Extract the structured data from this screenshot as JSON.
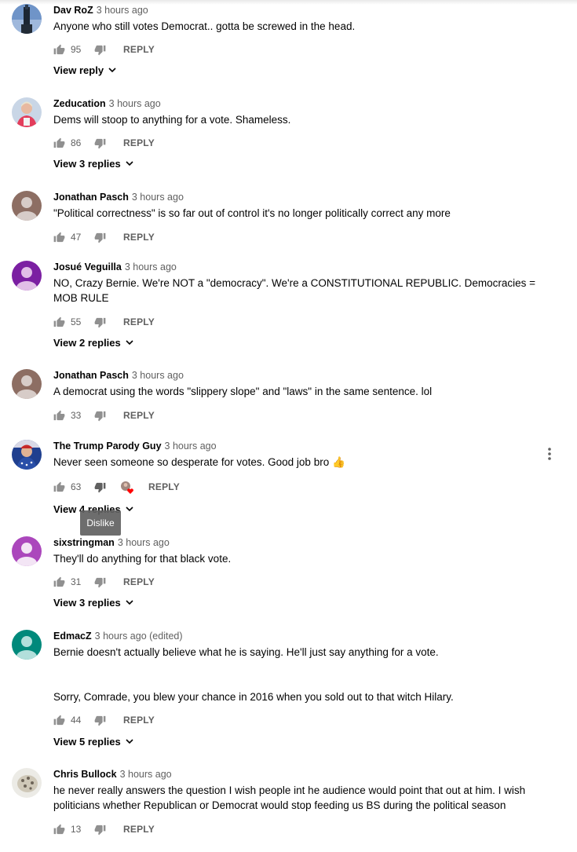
{
  "colors": {
    "text": "#030303",
    "secondary": "#606060",
    "icon": "#909090",
    "tooltip_bg": "#616161",
    "heart": "#ff0000"
  },
  "tooltip": {
    "label": "Dislike"
  },
  "comments": [
    {
      "author": "Dav RoZ",
      "time": "3 hours ago",
      "text": [
        "Anyone who still votes Democrat.. gotta be screwed in the head."
      ],
      "likes": "95",
      "reply_label": "REPLY",
      "view_replies": "View reply",
      "avatar": "tower-photo"
    },
    {
      "author": "Zeducation",
      "time": "3 hours ago",
      "text": [
        "Dems will stoop to anything for a vote. Shameless."
      ],
      "likes": "86",
      "reply_label": "REPLY",
      "view_replies": "View 3 replies",
      "avatar": "person-photo"
    },
    {
      "author": "Jonathan Pasch",
      "time": "3 hours ago",
      "text": [
        "\"Political correctness\" is so far out of control it's no longer politically correct any more"
      ],
      "likes": "47",
      "reply_label": "REPLY",
      "view_replies": "",
      "avatar": "default-brown"
    },
    {
      "author": "Josué Veguilla",
      "time": "3 hours ago",
      "text": [
        "NO, Crazy Bernie. We're NOT a \"democracy\". We're a CONSTITUTIONAL REPUBLIC. Democracies = MOB RULE"
      ],
      "likes": "55",
      "reply_label": "REPLY",
      "view_replies": "View 2 replies",
      "avatar": "default-purple"
    },
    {
      "author": "Jonathan Pasch",
      "time": "3 hours ago",
      "text": [
        "A democrat using the words \"slippery slope\" and \"laws\" in the same sentence. lol"
      ],
      "likes": "33",
      "reply_label": "REPLY",
      "view_replies": "",
      "avatar": "default-brown"
    },
    {
      "author": "The Trump Parody Guy",
      "time": "3 hours ago",
      "text": [
        "Never seen someone so desperate for votes. Good job bro 👍"
      ],
      "likes": "63",
      "reply_label": "REPLY",
      "view_replies": "View 4 replies",
      "avatar": "flag-photo",
      "hearted": true
    },
    {
      "author": "sixstringman",
      "time": "3 hours ago",
      "text": [
        "They'll do anything for that black vote."
      ],
      "likes": "31",
      "reply_label": "REPLY",
      "view_replies": "View 3 replies",
      "avatar": "default-magenta"
    },
    {
      "author": "EdmacZ",
      "time": "3 hours ago (edited)",
      "text": [
        "Bernie doesn't actually believe what he is saying. He'll just say anything for a vote.",
        "",
        "",
        "Sorry, Comrade, you blew your chance in 2016 when you sold out to that witch Hilary."
      ],
      "likes": "44",
      "reply_label": "REPLY",
      "view_replies": "View 5 replies",
      "avatar": "default-teal"
    },
    {
      "author": "Chris Bullock",
      "time": "3 hours ago",
      "text": [
        "he never really answers the question I wish people int he audience would point that out at him. I wish politicians whether Republican or Democrat would stop feeding us BS during the  political season"
      ],
      "likes": "13",
      "reply_label": "REPLY",
      "view_replies": "",
      "avatar": "leopard-photo"
    }
  ]
}
